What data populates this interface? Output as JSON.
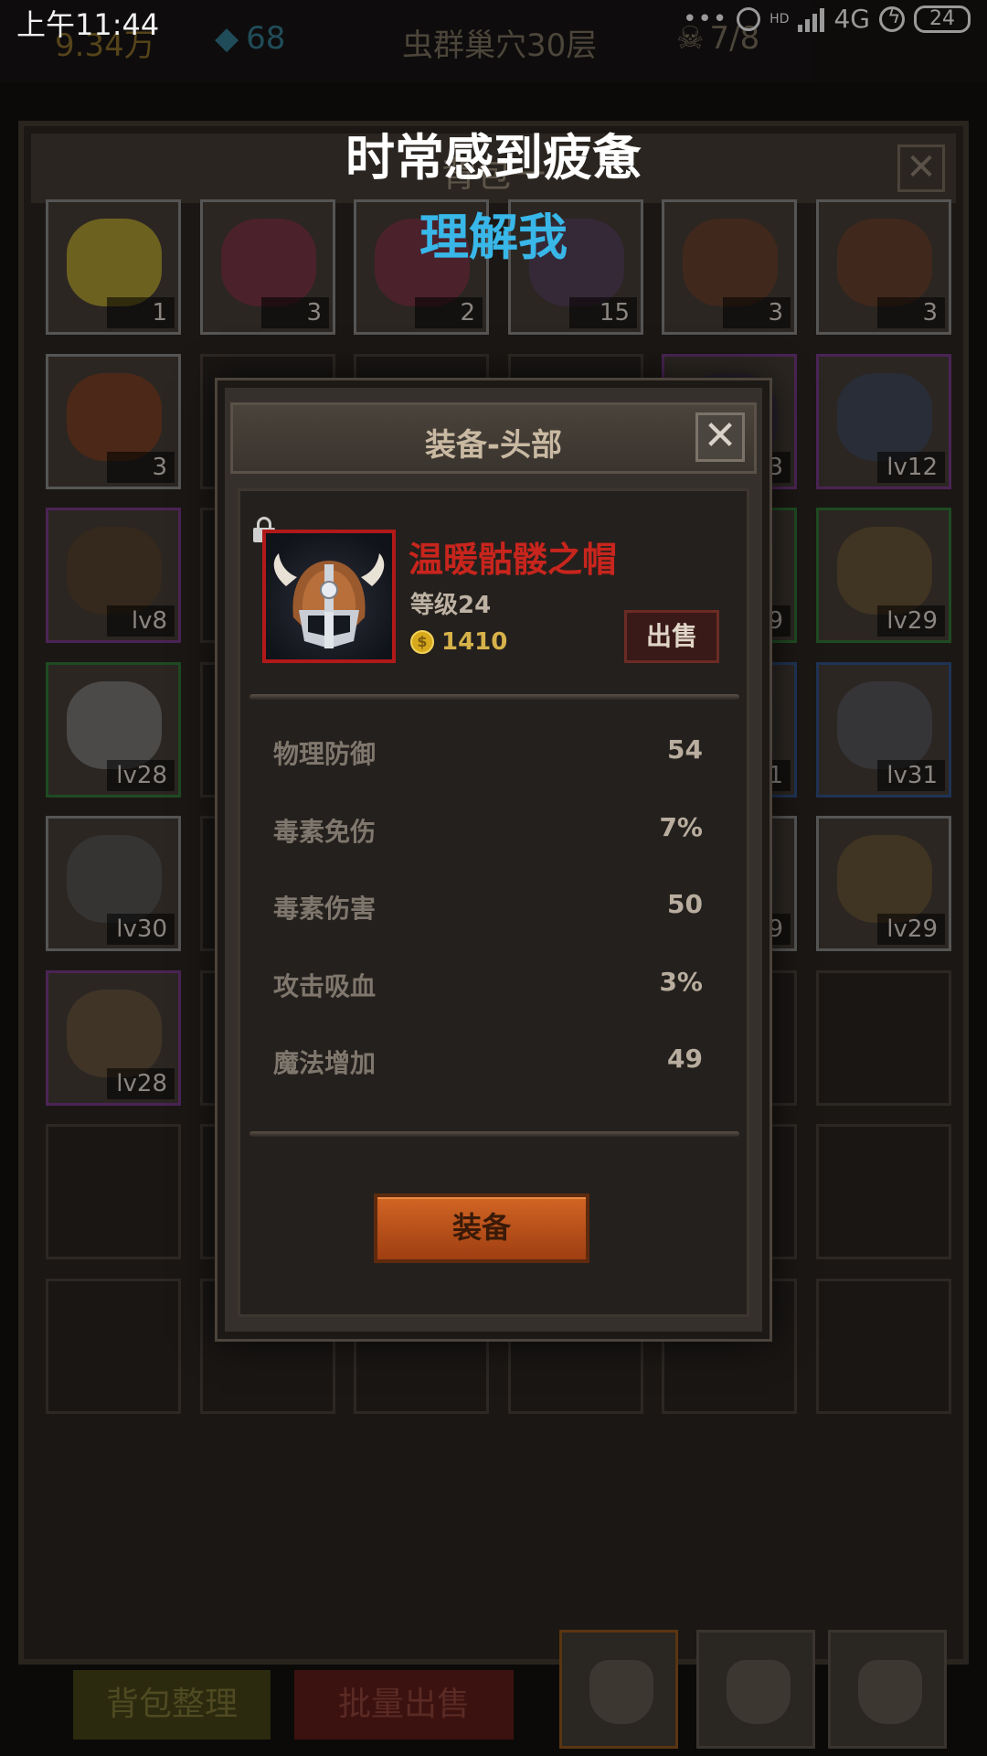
{
  "status_bar": {
    "time": "上午11:44",
    "network": "4G",
    "hd": "HD",
    "battery": "24",
    "dots": "•••"
  },
  "hud": {
    "gold": "9.34万",
    "gems": "68",
    "floor": "虫群巢穴30层",
    "kills": "7/8"
  },
  "backpack": {
    "title": "背包一",
    "close_label": "✕",
    "sort_label": "背包整理",
    "bulk_sell_label": "批量出售",
    "visible_slot_labels": [
      "1",
      "3",
      "2",
      "15",
      "3",
      "3",
      "3",
      "3",
      "lv12",
      "lv8",
      "9",
      "lv29",
      "lv28",
      "1",
      "lv31",
      "lv30",
      "9",
      "lv29",
      "lv28"
    ]
  },
  "lyrics": {
    "line1": "时常感到疲惫",
    "line2": "理解我"
  },
  "dialog": {
    "title": "装备-头部",
    "close_label": "✕",
    "item": {
      "name": "温暖骷髅之帽",
      "level": "等级24",
      "price": "1410",
      "coin_symbol": "$",
      "rarity_color": "#c7251d"
    },
    "sell_label": "出售",
    "equip_label": "装备",
    "stats": [
      {
        "name": "物理防御",
        "value": "54"
      },
      {
        "name": "毒素免伤",
        "value": "7%"
      },
      {
        "name": "毒素伤害",
        "value": "50"
      },
      {
        "name": "攻击吸血",
        "value": "3%"
      },
      {
        "name": "魔法增加",
        "value": "49"
      }
    ]
  },
  "colors": {
    "lyric_accent": "#38b7e8",
    "item_name": "#c7251d",
    "equip_button": "#c85a1e"
  }
}
